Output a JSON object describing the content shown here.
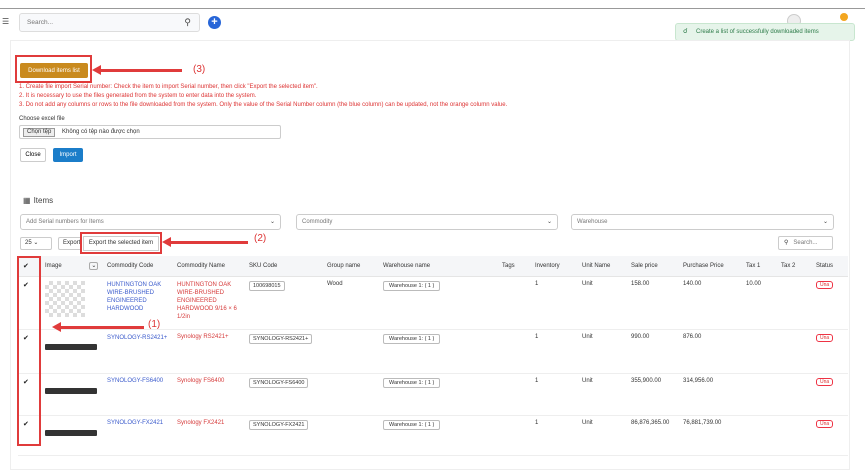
{
  "header": {
    "search_placeholder": "Search...",
    "toast_text": "Create a list of successfully downloaded items",
    "toast_icon": "bell-icon",
    "plus_symbol": "+"
  },
  "import_panel": {
    "download_label": "Download items list",
    "instructions": [
      "1. Create file import Serial number: Check the item to import Serial number, then click \"Export the selected item\".",
      "2. It is necessary to use the files generated from the system to enter data into the system.",
      "3. Do not add any columns or rows to the file downloaded from the system. Only the value of the Serial Number column (the blue column) can be updated, not the orange column value."
    ],
    "choose_label": "Choose excel file",
    "file_button": "Chọn tệp",
    "file_status": "Không có tệp nào được chọn",
    "close_label": "Close",
    "import_label": "Import"
  },
  "items": {
    "title": "Items",
    "filter_serial": "Add Serial numbers for Items",
    "filter_commodity": "Commodity",
    "filter_warehouse": "Warehouse",
    "page_size": "25",
    "export_label": "Export",
    "export_selected_label": "Export the selected item",
    "search_placeholder": "Search...",
    "columns": [
      "Image",
      "Commodity Code",
      "Commodity Name",
      "SKU Code",
      "Group name",
      "Warehouse name",
      "Tags",
      "Inventory",
      "Unit Name",
      "Sale price",
      "Purchase Price",
      "Tax 1",
      "Tax 2",
      "Status"
    ],
    "rows": [
      {
        "check": "✔",
        "code": "HUNTINGTON OAK WIRE-BRUSHED ENGINEERED HARDWOOD",
        "name": "HUNTINGTON OAK WIRE-BRUSHED ENGINEERED HARDWOOD 9/16 × 6 1/2in",
        "sku": "100698015",
        "group": "Wood",
        "warehouse": "Warehouse 1: ( 1 )",
        "tags": "",
        "inventory": "1",
        "unit": "Unit",
        "sale": "158.00",
        "purchase": "140.00",
        "tax1": "10.00",
        "tax2": "",
        "status": "Una"
      },
      {
        "check": "✔",
        "code": "SYNOLOGY-RS2421+",
        "name": "Synology RS2421+",
        "sku": "SYNOLOGY-RS2421+",
        "group": "",
        "warehouse": "Warehouse 1: ( 1 )",
        "tags": "",
        "inventory": "1",
        "unit": "Unit",
        "sale": "990.00",
        "purchase": "876.00",
        "tax1": "",
        "tax2": "",
        "status": "Una"
      },
      {
        "check": "✔",
        "code": "SYNOLOGY-FS6400",
        "name": "Synology FS6400",
        "sku": "SYNOLOGY-FS6400",
        "group": "",
        "warehouse": "Warehouse 1: ( 1 )",
        "tags": "",
        "inventory": "1",
        "unit": "Unit",
        "sale": "355,900.00",
        "purchase": "314,956.00",
        "tax1": "",
        "tax2": "",
        "status": "Una"
      },
      {
        "check": "✔",
        "code": "SYNOLOGY-FX2421",
        "name": "Synology FX2421",
        "sku": "SYNOLOGY-FX2421",
        "group": "",
        "warehouse": "Warehouse 1: ( 1 )",
        "tags": "",
        "inventory": "1",
        "unit": "Unit",
        "sale": "86,876,365.00",
        "purchase": "76,881,739.00",
        "tax1": "",
        "tax2": "",
        "status": "Una"
      }
    ]
  },
  "annotations": {
    "step1": "(1)",
    "step2": "(2)",
    "step3": "(3)",
    "color": "#e03b3b"
  }
}
